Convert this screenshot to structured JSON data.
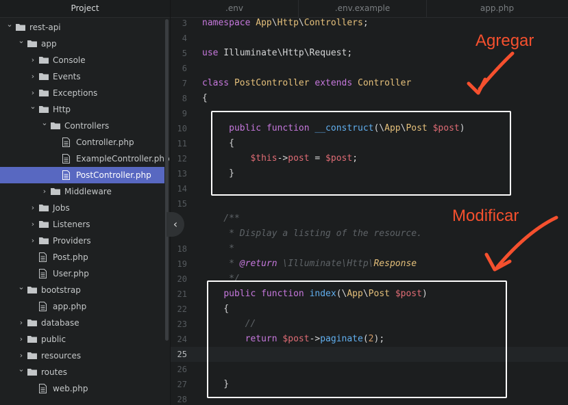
{
  "sidebar": {
    "title": "Project",
    "tree": [
      {
        "label": "rest-api",
        "type": "folder",
        "depth": 0,
        "expanded": true
      },
      {
        "label": "app",
        "type": "folder",
        "depth": 1,
        "expanded": true
      },
      {
        "label": "Console",
        "type": "folder",
        "depth": 2,
        "expanded": false
      },
      {
        "label": "Events",
        "type": "folder",
        "depth": 2,
        "expanded": false
      },
      {
        "label": "Exceptions",
        "type": "folder",
        "depth": 2,
        "expanded": false
      },
      {
        "label": "Http",
        "type": "folder",
        "depth": 2,
        "expanded": true
      },
      {
        "label": "Controllers",
        "type": "folder",
        "depth": 3,
        "expanded": true
      },
      {
        "label": "Controller.php",
        "type": "file",
        "depth": 4
      },
      {
        "label": "ExampleController.php",
        "type": "file",
        "depth": 4
      },
      {
        "label": "PostController.php",
        "type": "file",
        "depth": 4,
        "selected": true
      },
      {
        "label": "Middleware",
        "type": "folder",
        "depth": 3,
        "expanded": false
      },
      {
        "label": "Jobs",
        "type": "folder",
        "depth": 2,
        "expanded": false
      },
      {
        "label": "Listeners",
        "type": "folder",
        "depth": 2,
        "expanded": false
      },
      {
        "label": "Providers",
        "type": "folder",
        "depth": 2,
        "expanded": false
      },
      {
        "label": "Post.php",
        "type": "file",
        "depth": 2
      },
      {
        "label": "User.php",
        "type": "file",
        "depth": 2
      },
      {
        "label": "bootstrap",
        "type": "folder",
        "depth": 1,
        "expanded": true
      },
      {
        "label": "app.php",
        "type": "file",
        "depth": 2
      },
      {
        "label": "database",
        "type": "folder",
        "depth": 1,
        "expanded": false
      },
      {
        "label": "public",
        "type": "folder",
        "depth": 1,
        "expanded": false
      },
      {
        "label": "resources",
        "type": "folder",
        "depth": 1,
        "expanded": false
      },
      {
        "label": "routes",
        "type": "folder",
        "depth": 1,
        "expanded": true
      },
      {
        "label": "web.php",
        "type": "file",
        "depth": 2
      }
    ]
  },
  "tabs": [
    {
      "label": ".env"
    },
    {
      "label": ".env.example"
    },
    {
      "label": "app.php"
    }
  ],
  "editor": {
    "active_line": "25",
    "lines": [
      {
        "n": "3",
        "tokens": [
          [
            "kw",
            "namespace"
          ],
          [
            "plain",
            " "
          ],
          [
            "cls",
            "App"
          ],
          [
            "plain",
            "\\"
          ],
          [
            "cls",
            "Http"
          ],
          [
            "plain",
            "\\"
          ],
          [
            "cls",
            "Controllers"
          ],
          [
            "plain",
            ";"
          ]
        ]
      },
      {
        "n": "4",
        "tokens": []
      },
      {
        "n": "5",
        "tokens": [
          [
            "kw",
            "use"
          ],
          [
            "plain",
            " Illuminate\\Http\\Request;"
          ]
        ]
      },
      {
        "n": "6",
        "tokens": []
      },
      {
        "n": "7",
        "tokens": [
          [
            "kw",
            "class"
          ],
          [
            "plain",
            " "
          ],
          [
            "cls",
            "PostController"
          ],
          [
            "plain",
            " "
          ],
          [
            "kw",
            "extends"
          ],
          [
            "plain",
            " "
          ],
          [
            "cls",
            "Controller"
          ]
        ]
      },
      {
        "n": "8",
        "tokens": [
          [
            "plain",
            "{"
          ]
        ]
      },
      {
        "n": "9",
        "tokens": []
      },
      {
        "n": "10",
        "tokens": [
          [
            "plain",
            "     "
          ],
          [
            "kw",
            "public"
          ],
          [
            "plain",
            " "
          ],
          [
            "kw",
            "function"
          ],
          [
            "plain",
            " "
          ],
          [
            "fn",
            "__construct"
          ],
          [
            "plain",
            "(\\"
          ],
          [
            "cls",
            "App"
          ],
          [
            "plain",
            "\\"
          ],
          [
            "cls",
            "Post"
          ],
          [
            "plain",
            " "
          ],
          [
            "var",
            "$post"
          ],
          [
            "plain",
            ")"
          ]
        ]
      },
      {
        "n": "11",
        "tokens": [
          [
            "plain",
            "     {"
          ]
        ]
      },
      {
        "n": "12",
        "tokens": [
          [
            "plain",
            "         "
          ],
          [
            "var",
            "$this"
          ],
          [
            "plain",
            "->"
          ],
          [
            "var",
            "post"
          ],
          [
            "plain",
            " = "
          ],
          [
            "var",
            "$post"
          ],
          [
            "plain",
            ";"
          ]
        ]
      },
      {
        "n": "13",
        "tokens": [
          [
            "plain",
            "     }"
          ]
        ]
      },
      {
        "n": "14",
        "tokens": []
      },
      {
        "n": "15",
        "tokens": []
      },
      {
        "n": "",
        "tokens": [
          [
            "cm",
            "    /**"
          ]
        ]
      },
      {
        "n": "",
        "tokens": [
          [
            "cm",
            "     * Display a listing of the resource."
          ]
        ]
      },
      {
        "n": "18",
        "tokens": [
          [
            "cm",
            "     *"
          ]
        ]
      },
      {
        "n": "19",
        "tokens": [
          [
            "cm",
            "     * "
          ],
          [
            "cm-tag",
            "@return"
          ],
          [
            "cm",
            " \\Illuminate\\Http\\"
          ],
          [
            "cm-type",
            "Response"
          ]
        ]
      },
      {
        "n": "20",
        "tokens": [
          [
            "cm",
            "     */"
          ]
        ]
      },
      {
        "n": "21",
        "tokens": [
          [
            "plain",
            "    "
          ],
          [
            "kw",
            "public"
          ],
          [
            "plain",
            " "
          ],
          [
            "kw",
            "function"
          ],
          [
            "plain",
            " "
          ],
          [
            "fn",
            "index"
          ],
          [
            "plain",
            "(\\"
          ],
          [
            "cls",
            "App"
          ],
          [
            "plain",
            "\\"
          ],
          [
            "cls",
            "Post"
          ],
          [
            "plain",
            " "
          ],
          [
            "var",
            "$post"
          ],
          [
            "plain",
            ")"
          ]
        ]
      },
      {
        "n": "22",
        "tokens": [
          [
            "plain",
            "    {"
          ]
        ]
      },
      {
        "n": "23",
        "tokens": [
          [
            "cm",
            "        //"
          ]
        ]
      },
      {
        "n": "24",
        "tokens": [
          [
            "plain",
            "        "
          ],
          [
            "kw",
            "return"
          ],
          [
            "plain",
            " "
          ],
          [
            "var",
            "$post"
          ],
          [
            "plain",
            "->"
          ],
          [
            "fn",
            "paginate"
          ],
          [
            "plain",
            "("
          ],
          [
            "num",
            "2"
          ],
          [
            "plain",
            ");"
          ]
        ]
      },
      {
        "n": "25",
        "tokens": []
      },
      {
        "n": "26",
        "tokens": []
      },
      {
        "n": "27",
        "tokens": [
          [
            "plain",
            "    }"
          ]
        ]
      },
      {
        "n": "28",
        "tokens": []
      }
    ]
  },
  "annotations": {
    "add": "Agregar",
    "modify": "Modificar",
    "color": "#f5502e"
  },
  "colors": {
    "keyword": "#c678dd",
    "function": "#61afef",
    "class": "#e5c07b",
    "variable": "#e06c75",
    "selection": "#5868c1"
  }
}
